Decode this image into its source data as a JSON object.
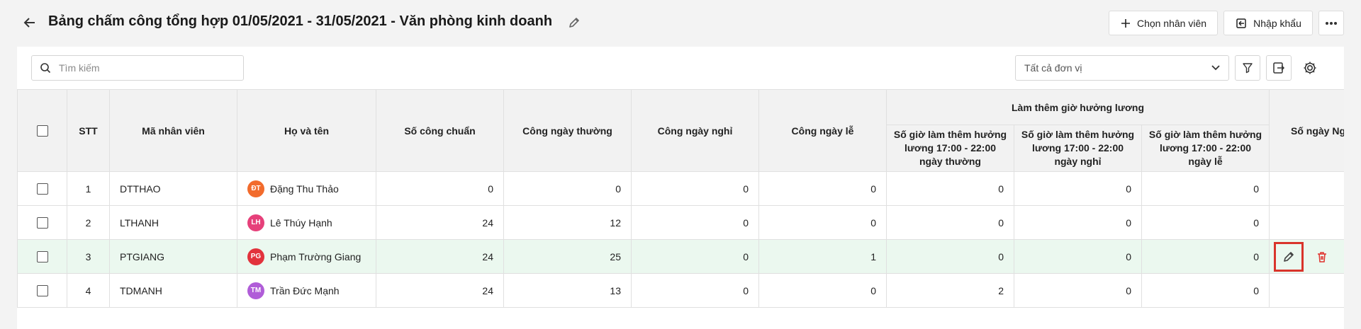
{
  "header": {
    "title": "Bảng chấm công tổng hợp 01/05/2021 - 31/05/2021 - Văn phòng kinh doanh",
    "buttons": {
      "select_employee": "Chọn nhân viên",
      "import": "Nhập khẩu"
    }
  },
  "toolbar": {
    "search_placeholder": "Tìm kiếm",
    "unit_select_value": "Tất cả đơn vị"
  },
  "table": {
    "headers": {
      "stt": "STT",
      "employee_code": "Mã nhân viên",
      "full_name": "Họ và tên",
      "standard_workdays": "Số công chuẩn",
      "weekday_work": "Công ngày thường",
      "holiday_off_work": "Công ngày nghỉ",
      "public_holiday_work": "Công ngày lễ",
      "overtime_group": "Làm thêm giờ hưởng lương",
      "ot_weekday": "Số giờ làm thêm hưởng lương 17:00 - 22:00 ngày thường",
      "ot_dayoff": "Số giờ làm thêm hưởng lương 17:00 - 22:00 ngày nghỉ",
      "ot_holiday": "Số giờ làm thêm hưởng lương 17:00 - 22:00 ngày lễ",
      "days_off": "Số ngày Ng"
    },
    "rows": [
      {
        "stt": "1",
        "code": "DTTHAO",
        "initials": "ĐT",
        "avatar_color": "#f26b2c",
        "name": "Đặng Thu Thảo",
        "standard": "0",
        "weekday": "0",
        "dayoff": "0",
        "holiday": "0",
        "ot_weekday": "0",
        "ot_dayoff": "0",
        "ot_holiday": "0"
      },
      {
        "stt": "2",
        "code": "LTHANH",
        "initials": "LH",
        "avatar_color": "#e6407a",
        "name": "Lê Thúy Hạnh",
        "standard": "24",
        "weekday": "12",
        "dayoff": "0",
        "holiday": "0",
        "ot_weekday": "0",
        "ot_dayoff": "0",
        "ot_holiday": "0"
      },
      {
        "stt": "3",
        "code": "PTGIANG",
        "initials": "PG",
        "avatar_color": "#e2323c",
        "name": "Phạm Trường Giang",
        "standard": "24",
        "weekday": "25",
        "dayoff": "0",
        "holiday": "1",
        "ot_weekday": "0",
        "ot_dayoff": "0",
        "ot_holiday": "0"
      },
      {
        "stt": "4",
        "code": "TDMANH",
        "initials": "TM",
        "avatar_color": "#b05dd8",
        "name": "Trần Đức Mạnh",
        "standard": "24",
        "weekday": "13",
        "dayoff": "0",
        "holiday": "0",
        "ot_weekday": "2",
        "ot_dayoff": "0",
        "ot_holiday": "0"
      }
    ]
  },
  "colors": {
    "highlight_row": "#ebf8ef",
    "edit_border": "#d9342b",
    "delete_icon": "#e0312c"
  }
}
